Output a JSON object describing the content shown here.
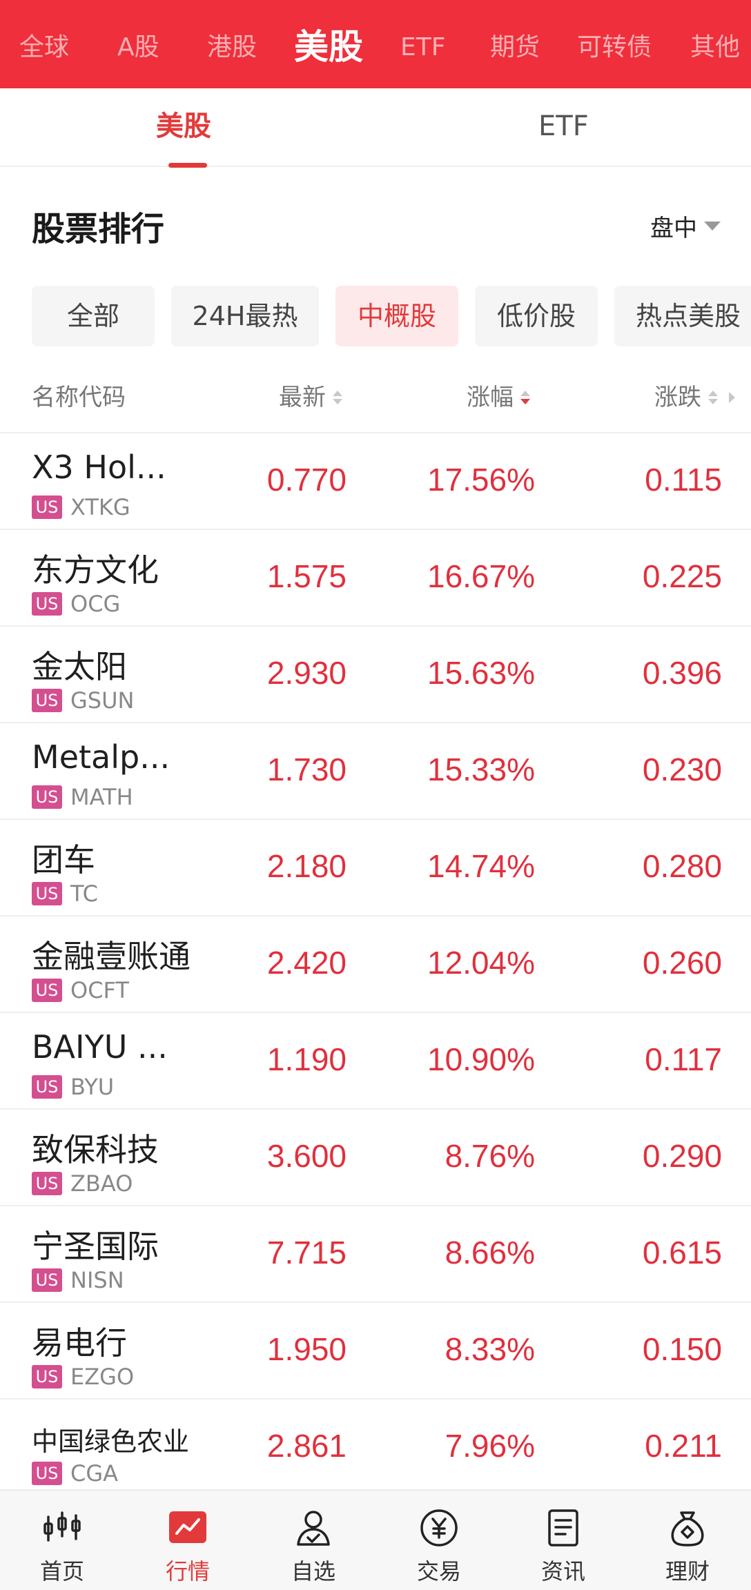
{
  "market_tabs": [
    "全球",
    "A股",
    "港股",
    "美股",
    "ETF",
    "期货",
    "可转债",
    "其他"
  ],
  "market_active": "美股",
  "sub_tabs": [
    "美股",
    "ETF"
  ],
  "section": {
    "title": "股票排行",
    "session": "盘中"
  },
  "chips": [
    "全部",
    "24H最热",
    "中概股",
    "低价股",
    "热点美股"
  ],
  "columns": {
    "name": "名称代码",
    "price": "最新",
    "pct": "涨幅",
    "chg": "涨跌"
  },
  "badge_label": "US",
  "rows": [
    {
      "name": "X3 Hol...",
      "code": "XTKG",
      "price": "0.770",
      "pct": "17.56%",
      "chg": "0.115"
    },
    {
      "name": "东方文化",
      "code": "OCG",
      "price": "1.575",
      "pct": "16.67%",
      "chg": "0.225"
    },
    {
      "name": "金太阳",
      "code": "GSUN",
      "price": "2.930",
      "pct": "15.63%",
      "chg": "0.396"
    },
    {
      "name": "Metalp...",
      "code": "MATH",
      "price": "1.730",
      "pct": "15.33%",
      "chg": "0.230"
    },
    {
      "name": "团车",
      "code": "TC",
      "price": "2.180",
      "pct": "14.74%",
      "chg": "0.280"
    },
    {
      "name": "金融壹账通",
      "code": "OCFT",
      "price": "2.420",
      "pct": "12.04%",
      "chg": "0.260"
    },
    {
      "name": "BAIYU ...",
      "code": "BYU",
      "price": "1.190",
      "pct": "10.90%",
      "chg": "0.117"
    },
    {
      "name": "致保科技",
      "code": "ZBAO",
      "price": "3.600",
      "pct": "8.76%",
      "chg": "0.290"
    },
    {
      "name": "宁圣国际",
      "code": "NISN",
      "price": "7.715",
      "pct": "8.66%",
      "chg": "0.615"
    },
    {
      "name": "易电行",
      "code": "EZGO",
      "price": "1.950",
      "pct": "8.33%",
      "chg": "0.150"
    },
    {
      "name": "中国绿色农业",
      "code": "CGA",
      "price": "2.861",
      "pct": "7.96%",
      "chg": "0.211"
    }
  ],
  "bottom_nav": [
    "首页",
    "行情",
    "自选",
    "交易",
    "资讯",
    "理财"
  ],
  "bottom_nav_active": "行情",
  "colors": {
    "brand_red": "#ef2f3b",
    "up_red": "#e0303d",
    "badge": "#d44f8f"
  }
}
